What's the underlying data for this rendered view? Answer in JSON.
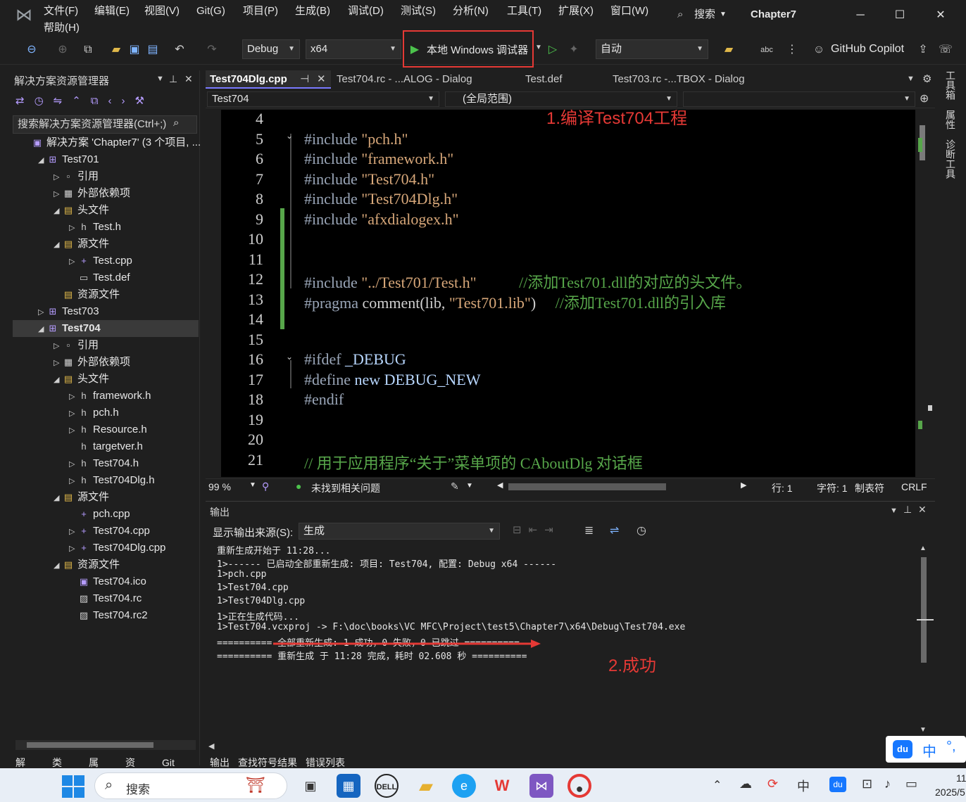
{
  "menu": {
    "items": [
      "文件(F)",
      "编辑(E)",
      "视图(V)",
      "Git(G)",
      "项目(P)",
      "生成(B)",
      "调试(D)",
      "测试(S)",
      "分析(N)",
      "工具(T)",
      "扩展(X)",
      "窗口(W)"
    ],
    "help": "帮助(H)",
    "search": "搜索",
    "solution_name": "Chapter7"
  },
  "toolbar": {
    "config": "Debug",
    "platform": "x64",
    "run_label": "本地 Windows 调试器",
    "auto": "自动",
    "copilot": "GitHub Copilot"
  },
  "solution_explorer": {
    "title": "解决方案资源管理器",
    "search_placeholder": "搜索解决方案资源管理器(Ctrl+;)",
    "tree": [
      {
        "indent": 0,
        "tw": "",
        "icon": "▣",
        "label": "解决方案 'Chapter7' (3 个项目, ..."
      },
      {
        "indent": 1,
        "tw": "◢",
        "icon": "⊞",
        "label": "Test701"
      },
      {
        "indent": 2,
        "tw": "▷",
        "icon": "▫",
        "label": "引用"
      },
      {
        "indent": 2,
        "tw": "▷",
        "icon": "▦",
        "label": "外部依赖项"
      },
      {
        "indent": 2,
        "tw": "◢",
        "icon": "▤",
        "label": "头文件"
      },
      {
        "indent": 3,
        "tw": "▷",
        "icon": "h",
        "label": "Test.h"
      },
      {
        "indent": 2,
        "tw": "◢",
        "icon": "▤",
        "label": "源文件"
      },
      {
        "indent": 3,
        "tw": "▷",
        "icon": "+",
        "label": "Test.cpp"
      },
      {
        "indent": 3,
        "tw": "",
        "icon": "▭",
        "label": "Test.def"
      },
      {
        "indent": 2,
        "tw": "",
        "icon": "▤",
        "label": "资源文件"
      },
      {
        "indent": 1,
        "tw": "▷",
        "icon": "⊞",
        "label": "Test703"
      },
      {
        "indent": 1,
        "tw": "◢",
        "icon": "⊞",
        "label": "Test704"
      },
      {
        "indent": 2,
        "tw": "▷",
        "icon": "▫",
        "label": "引用"
      },
      {
        "indent": 2,
        "tw": "▷",
        "icon": "▦",
        "label": "外部依赖项"
      },
      {
        "indent": 2,
        "tw": "◢",
        "icon": "▤",
        "label": "头文件"
      },
      {
        "indent": 3,
        "tw": "▷",
        "icon": "h",
        "label": "framework.h"
      },
      {
        "indent": 3,
        "tw": "▷",
        "icon": "h",
        "label": "pch.h"
      },
      {
        "indent": 3,
        "tw": "▷",
        "icon": "h",
        "label": "Resource.h"
      },
      {
        "indent": 3,
        "tw": "",
        "icon": "h",
        "label": "targetver.h"
      },
      {
        "indent": 3,
        "tw": "▷",
        "icon": "h",
        "label": "Test704.h"
      },
      {
        "indent": 3,
        "tw": "▷",
        "icon": "h",
        "label": "Test704Dlg.h"
      },
      {
        "indent": 2,
        "tw": "◢",
        "icon": "▤",
        "label": "源文件"
      },
      {
        "indent": 3,
        "tw": "",
        "icon": "+",
        "label": "pch.cpp"
      },
      {
        "indent": 3,
        "tw": "▷",
        "icon": "+",
        "label": "Test704.cpp"
      },
      {
        "indent": 3,
        "tw": "▷",
        "icon": "+",
        "label": "Test704Dlg.cpp"
      },
      {
        "indent": 2,
        "tw": "◢",
        "icon": "▤",
        "label": "资源文件"
      },
      {
        "indent": 3,
        "tw": "",
        "icon": "▣",
        "label": "Test704.ico"
      },
      {
        "indent": 3,
        "tw": "",
        "icon": "▨",
        "label": "Test704.rc"
      },
      {
        "indent": 3,
        "tw": "",
        "icon": "▨",
        "label": "Test704.rc2"
      }
    ],
    "bottom_tabs": [
      "解",
      "类",
      "属",
      "资",
      "Git"
    ]
  },
  "editor": {
    "tabs": [
      "Test704Dlg.cpp",
      "Test704.rc - ...ALOG - Dialog",
      "Test.def",
      "Test703.rc -...TBOX - Dialog"
    ],
    "project_combo": "Test704",
    "scope_combo": "(全局范围)",
    "annotation1": "1.编译Test704工程",
    "lines": [
      {
        "n": "4",
        "parts": []
      },
      {
        "n": "5",
        "parts": [
          [
            "kw",
            "#include "
          ],
          [
            "str",
            "\"pch.h\""
          ]
        ]
      },
      {
        "n": "6",
        "parts": [
          [
            "kw",
            "#include "
          ],
          [
            "str",
            "\"framework.h\""
          ]
        ]
      },
      {
        "n": "7",
        "parts": [
          [
            "kw",
            "#include "
          ],
          [
            "str",
            "\"Test704.h\""
          ]
        ]
      },
      {
        "n": "8",
        "parts": [
          [
            "kw",
            "#include "
          ],
          [
            "str",
            "\"Test704Dlg.h\""
          ]
        ]
      },
      {
        "n": "9",
        "parts": [
          [
            "kw",
            "#include "
          ],
          [
            "str",
            "\"afxdialogex.h\""
          ]
        ]
      },
      {
        "n": "10",
        "parts": []
      },
      {
        "n": "11",
        "parts": []
      },
      {
        "n": "12",
        "parts": [
          [
            "kw",
            "#include "
          ],
          [
            "str",
            "\"../Test701/Test.h\""
          ],
          [
            "txt",
            "           "
          ],
          [
            "cmt",
            "//添加Test701.dll的对应的头文件。"
          ]
        ]
      },
      {
        "n": "13",
        "parts": [
          [
            "kw",
            "#pragma "
          ],
          [
            "txt",
            "comment(lib, "
          ],
          [
            "str",
            "\"Test701.lib\""
          ],
          [
            "txt",
            ")     "
          ],
          [
            "cmt",
            "//添加Test701.dll的引入库"
          ]
        ]
      },
      {
        "n": "14",
        "parts": []
      },
      {
        "n": "15",
        "parts": []
      },
      {
        "n": "16",
        "parts": [
          [
            "kw",
            "#ifdef "
          ],
          [
            "id",
            "_DEBUG"
          ]
        ]
      },
      {
        "n": "17",
        "parts": [
          [
            "kw",
            "#define "
          ],
          [
            "id",
            "new DEBUG_NEW"
          ]
        ]
      },
      {
        "n": "18",
        "parts": [
          [
            "kw",
            "#endif"
          ]
        ]
      },
      {
        "n": "19",
        "parts": []
      },
      {
        "n": "20",
        "parts": []
      },
      {
        "n": "21",
        "parts": [
          [
            "cmt",
            "// 用于应用程序“关于”菜单项的 CAboutDlg 对话框"
          ]
        ]
      }
    ],
    "status": {
      "zoom": "99 %",
      "issues": "未找到相关问题",
      "line": "行: 1",
      "char": "字符: 1",
      "tabs": "制表符",
      "eol": "CRLF"
    }
  },
  "output": {
    "title": "输出",
    "source_label": "显示输出来源(S):",
    "source_value": "生成",
    "lines": [
      "重新生成开始于 11:28...",
      "1>------ 已启动全部重新生成: 项目: Test704, 配置: Debug x64 ------",
      "1>pch.cpp",
      "1>Test704.cpp",
      "1>Test704Dlg.cpp",
      "1>正在生成代码...",
      "1>Test704.vcxproj -> F:\\doc\\books\\VC MFC\\Project\\test5\\Chapter7\\x64\\Debug\\Test704.exe",
      "========== 全部重新生成: 1 成功，0 失败，0 已跳过 ==========",
      "========== 重新生成 于 11:28 完成，耗时 02.608 秒 =========="
    ],
    "annotation2": "2.成功",
    "bottom_tabs": [
      "输出",
      "查找符号结果",
      "错误列表"
    ]
  },
  "side_tabs": [
    "工具箱",
    "属性",
    "诊断工具"
  ],
  "taskbar": {
    "search": "搜索",
    "time": "11",
    "date": "2025/5",
    "ime": "中"
  }
}
